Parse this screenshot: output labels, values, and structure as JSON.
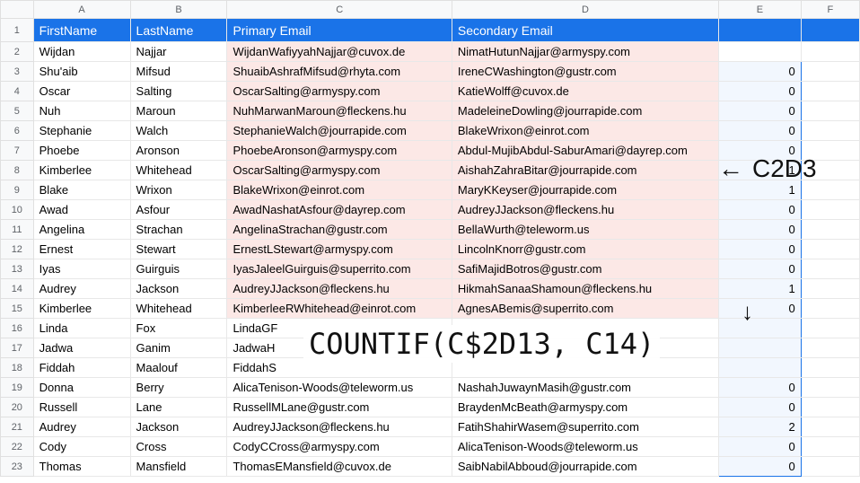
{
  "columns": [
    "A",
    "B",
    "C",
    "D",
    "E",
    "F"
  ],
  "headerRow": {
    "A": "FirstName",
    "B": "LastName",
    "C": "Primary Email",
    "D": "Secondary Email"
  },
  "rows": [
    {
      "n": 2,
      "A": "Wijdan",
      "B": "Najjar",
      "C": "WijdanWafiyyahNajjar@cuvox.de",
      "D": "NimatHutunNajjar@armyspy.com",
      "E": "",
      "hl": true
    },
    {
      "n": 3,
      "A": "Shu'aib",
      "B": "Mifsud",
      "C": "ShuaibAshrafMifsud@rhyta.com",
      "D": "IreneCWashington@gustr.com",
      "E": "0",
      "hl": true
    },
    {
      "n": 4,
      "A": "Oscar",
      "B": "Salting",
      "C": "OscarSalting@armyspy.com",
      "D": "KatieWolff@cuvox.de",
      "E": "0",
      "hl": true
    },
    {
      "n": 5,
      "A": "Nuh",
      "B": "Maroun",
      "C": "NuhMarwanMaroun@fleckens.hu",
      "D": "MadeleineDowling@jourrapide.com",
      "E": "0",
      "hl": true
    },
    {
      "n": 6,
      "A": "Stephanie",
      "B": "Walch",
      "C": "StephanieWalch@jourrapide.com",
      "D": "BlakeWrixon@einrot.com",
      "E": "0",
      "hl": true
    },
    {
      "n": 7,
      "A": "Phoebe",
      "B": "Aronson",
      "C": "PhoebeAronson@armyspy.com",
      "D": "Abdul-MujibAbdul-SaburAmari@dayrep.com",
      "E": "0",
      "hl": true
    },
    {
      "n": 8,
      "A": "Kimberlee",
      "B": "Whitehead",
      "C": "OscarSalting@armyspy.com",
      "D": "AishahZahraBitar@jourrapide.com",
      "E": "1",
      "hl": true
    },
    {
      "n": 9,
      "A": "Blake",
      "B": "Wrixon",
      "C": "BlakeWrixon@einrot.com",
      "D": "MaryKKeyser@jourrapide.com",
      "E": "1",
      "hl": true
    },
    {
      "n": 10,
      "A": "Awad",
      "B": "Asfour",
      "C": "AwadNashatAsfour@dayrep.com",
      "D": "AudreyJJackson@fleckens.hu",
      "E": "0",
      "hl": true
    },
    {
      "n": 11,
      "A": "Angelina",
      "B": "Strachan",
      "C": "AngelinaStrachan@gustr.com",
      "D": "BellaWurth@teleworm.us",
      "E": "0",
      "hl": true
    },
    {
      "n": 12,
      "A": "Ernest",
      "B": "Stewart",
      "C": "ErnestLStewart@armyspy.com",
      "D": "LincolnKnorr@gustr.com",
      "E": "0",
      "hl": true
    },
    {
      "n": 13,
      "A": "Iyas",
      "B": "Guirguis",
      "C": "IyasJaleelGuirguis@superrito.com",
      "D": "SafiMajidBotros@gustr.com",
      "E": "0",
      "hl": true
    },
    {
      "n": 14,
      "A": "Audrey",
      "B": "Jackson",
      "C": "AudreyJJackson@fleckens.hu",
      "D": "HikmahSanaaShamoun@fleckens.hu",
      "E": "1",
      "hl": true
    },
    {
      "n": 15,
      "A": "Kimberlee",
      "B": "Whitehead",
      "C": "KimberleeRWhitehead@einrot.com",
      "D": "AgnesABemis@superrito.com",
      "E": "0",
      "hl": true
    },
    {
      "n": 16,
      "A": "Linda",
      "B": "Fox",
      "C": "LindaGF",
      "D": "",
      "E": "",
      "hl": false
    },
    {
      "n": 17,
      "A": "Jadwa",
      "B": "Ganim",
      "C": "JadwaH",
      "D": "",
      "E": "",
      "hl": false
    },
    {
      "n": 18,
      "A": "Fiddah",
      "B": "Maalouf",
      "C": "FiddahS",
      "D": "",
      "E": "",
      "hl": false
    },
    {
      "n": 19,
      "A": "Donna",
      "B": "Berry",
      "C": "AlicaTenison-Woods@teleworm.us",
      "D": "NashahJuwaynMasih@gustr.com",
      "E": "0",
      "hl": false
    },
    {
      "n": 20,
      "A": "Russell",
      "B": "Lane",
      "C": "RussellMLane@gustr.com",
      "D": "BraydenMcBeath@armyspy.com",
      "E": "0",
      "hl": false
    },
    {
      "n": 21,
      "A": "Audrey",
      "B": "Jackson",
      "C": "AudreyJJackson@fleckens.hu",
      "D": "FatihShahirWasem@superrito.com",
      "E": "2",
      "hl": false
    },
    {
      "n": 22,
      "A": "Cody",
      "B": "Cross",
      "C": "CodyCCross@armyspy.com",
      "D": "AlicaTenison-Woods@teleworm.us",
      "E": "0",
      "hl": false
    },
    {
      "n": 23,
      "A": "Thomas",
      "B": "Mansfield",
      "C": "ThomasEMansfield@cuvox.de",
      "D": "SaibNabilAbboud@jourrapide.com",
      "E": "0",
      "hl": false
    }
  ],
  "selection": {
    "col": "E",
    "fromRow": 3,
    "toRow": 23
  },
  "annotations": {
    "arrowRef": "C2D3",
    "formula": "COUNTIF(C$2D13, C14)"
  }
}
